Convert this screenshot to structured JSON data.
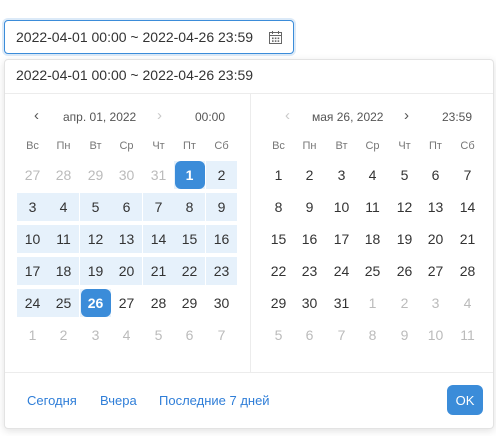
{
  "trigger": {
    "value": "2022-04-01 00:00 ~ 2022-04-26 23:59",
    "icon": "calendar-icon"
  },
  "panel_header": {
    "value": "2022-04-01 00:00 ~ 2022-04-26 23:59"
  },
  "left": {
    "prev": "‹",
    "month": "апр. 01, 2022",
    "next": "›",
    "time": "00:00",
    "weekdays": [
      "Вс",
      "Пн",
      "Вт",
      "Ср",
      "Чт",
      "Пт",
      "Сб"
    ],
    "rows": [
      [
        "27",
        "28",
        "29",
        "30",
        "31",
        "1",
        "2"
      ],
      [
        "3",
        "4",
        "5",
        "6",
        "7",
        "8",
        "9"
      ],
      [
        "10",
        "11",
        "12",
        "13",
        "14",
        "15",
        "16"
      ],
      [
        "17",
        "18",
        "19",
        "20",
        "21",
        "22",
        "23"
      ],
      [
        "24",
        "25",
        "26",
        "27",
        "28",
        "29",
        "30"
      ],
      [
        "1",
        "2",
        "3",
        "4",
        "5",
        "6",
        "7"
      ]
    ],
    "muted": [
      [
        0,
        0
      ],
      [
        0,
        1
      ],
      [
        0,
        2
      ],
      [
        0,
        3
      ],
      [
        0,
        4
      ],
      [
        5,
        0
      ],
      [
        5,
        1
      ],
      [
        5,
        2
      ],
      [
        5,
        3
      ],
      [
        5,
        4
      ],
      [
        5,
        5
      ],
      [
        5,
        6
      ]
    ],
    "range": [
      [
        0,
        5
      ],
      [
        0,
        6
      ],
      [
        1,
        0
      ],
      [
        1,
        1
      ],
      [
        1,
        2
      ],
      [
        1,
        3
      ],
      [
        1,
        4
      ],
      [
        1,
        5
      ],
      [
        1,
        6
      ],
      [
        2,
        0
      ],
      [
        2,
        1
      ],
      [
        2,
        2
      ],
      [
        2,
        3
      ],
      [
        2,
        4
      ],
      [
        2,
        5
      ],
      [
        2,
        6
      ],
      [
        3,
        0
      ],
      [
        3,
        1
      ],
      [
        3,
        2
      ],
      [
        3,
        3
      ],
      [
        3,
        4
      ],
      [
        3,
        5
      ],
      [
        3,
        6
      ],
      [
        4,
        0
      ],
      [
        4,
        1
      ],
      [
        4,
        2
      ]
    ],
    "selected": [
      [
        0,
        5
      ],
      [
        4,
        2
      ]
    ]
  },
  "right": {
    "prev": "‹",
    "month": "мая 26, 2022",
    "next": "›",
    "time": "23:59",
    "weekdays": [
      "Вс",
      "Пн",
      "Вт",
      "Ср",
      "Чт",
      "Пт",
      "Сб"
    ],
    "rows": [
      [
        "1",
        "2",
        "3",
        "4",
        "5",
        "6",
        "7"
      ],
      [
        "8",
        "9",
        "10",
        "11",
        "12",
        "13",
        "14"
      ],
      [
        "15",
        "16",
        "17",
        "18",
        "19",
        "20",
        "21"
      ],
      [
        "22",
        "23",
        "24",
        "25",
        "26",
        "27",
        "28"
      ],
      [
        "29",
        "30",
        "31",
        "1",
        "2",
        "3",
        "4"
      ],
      [
        "5",
        "6",
        "7",
        "8",
        "9",
        "10",
        "11"
      ]
    ],
    "muted": [
      [
        4,
        3
      ],
      [
        4,
        4
      ],
      [
        4,
        5
      ],
      [
        4,
        6
      ],
      [
        5,
        0
      ],
      [
        5,
        1
      ],
      [
        5,
        2
      ],
      [
        5,
        3
      ],
      [
        5,
        4
      ],
      [
        5,
        5
      ],
      [
        5,
        6
      ]
    ],
    "range": [],
    "selected": []
  },
  "footer": {
    "shortcuts": [
      "Сегодня",
      "Вчера",
      "Последние 7 дней"
    ],
    "ok_label": "OK"
  },
  "colors": {
    "accent": "#3b8cd9",
    "range_bg": "#e6f1fb",
    "link": "#2f7ed8"
  }
}
